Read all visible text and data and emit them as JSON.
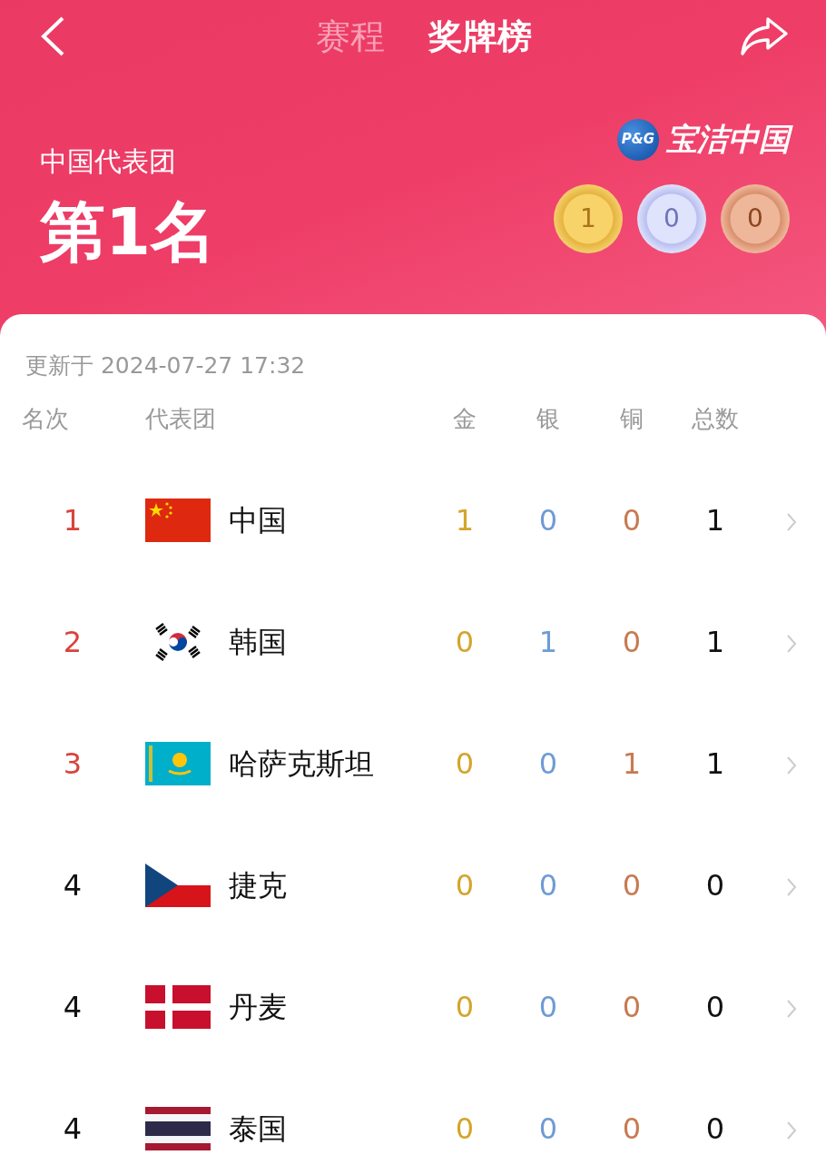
{
  "nav": {
    "tabs": [
      {
        "label": "赛程",
        "selected": false
      },
      {
        "label": "奖牌榜",
        "selected": true
      }
    ]
  },
  "summary": {
    "delegation": "中国代表团",
    "rank": "第1名",
    "sponsor_logo": "P&G",
    "sponsor": "宝洁中国",
    "medals": [
      {
        "kind": "gold",
        "count": "1"
      },
      {
        "kind": "silver",
        "count": "0"
      },
      {
        "kind": "bronze",
        "count": "0"
      }
    ]
  },
  "updated": "更新于 2024-07-27 17:32",
  "table": {
    "columns": [
      "名次",
      "代表团",
      "金",
      "银",
      "铜",
      "总数"
    ],
    "rows": [
      {
        "rank": "1",
        "top": true,
        "kind": "cn",
        "name": "中国",
        "gold": "1",
        "silver": "0",
        "bronze": "0",
        "total": "1"
      },
      {
        "rank": "2",
        "top": true,
        "kind": "kr",
        "name": "韩国",
        "gold": "0",
        "silver": "1",
        "bronze": "0",
        "total": "1"
      },
      {
        "rank": "3",
        "top": true,
        "kind": "kz",
        "name": "哈萨克斯坦",
        "gold": "0",
        "silver": "0",
        "bronze": "1",
        "total": "1"
      },
      {
        "rank": "4",
        "top": false,
        "kind": "cz",
        "name": "捷克",
        "gold": "0",
        "silver": "0",
        "bronze": "0",
        "total": "0"
      },
      {
        "rank": "4",
        "top": false,
        "kind": "dk",
        "name": "丹麦",
        "gold": "0",
        "silver": "0",
        "bronze": "0",
        "total": "0"
      },
      {
        "rank": "4",
        "top": false,
        "kind": "th",
        "name": "泰国",
        "gold": "0",
        "silver": "0",
        "bronze": "0",
        "total": "0"
      }
    ]
  }
}
